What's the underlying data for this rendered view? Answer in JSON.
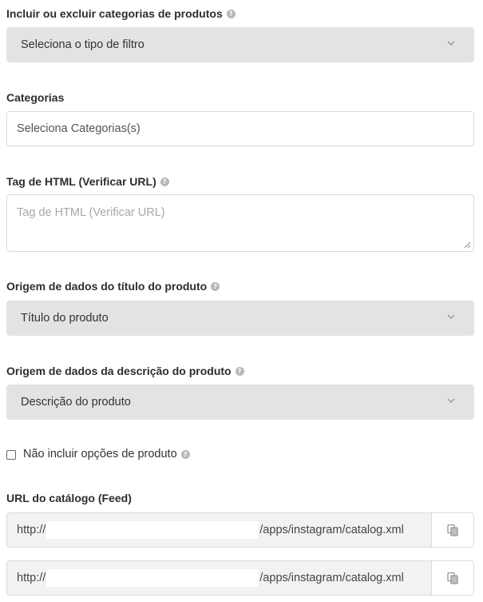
{
  "filter_type": {
    "label": "Incluir ou excluir categorias de produtos",
    "help_icon": "question-circle-icon",
    "value": "Seleciona o tipo de filtro"
  },
  "categories": {
    "label": "Categorias",
    "placeholder": "Seleciona Categorias(s)"
  },
  "html_tag": {
    "label": "Tag de HTML (Verificar URL)",
    "placeholder": "Tag de HTML (Verificar URL)"
  },
  "title_source": {
    "label": "Origem de dados do título do produto",
    "value": "Título do produto"
  },
  "description_source": {
    "label": "Origem de dados da descrição do produto",
    "value": "Descrição do produto"
  },
  "exclude_options": {
    "label": "Não incluir opções de produto",
    "checked": false
  },
  "catalog_url": {
    "label": "URL do catálogo (Feed)",
    "urls": [
      {
        "prefix": "http://",
        "suffix": "/apps/instagram/catalog.xml"
      },
      {
        "prefix": "http://",
        "suffix": "/apps/instagram/catalog.xml"
      }
    ],
    "copy_icon": "copy-icon"
  },
  "colors": {
    "select_bg": "#e3e3e3",
    "border": "#d9d9d9",
    "label_text": "#2d2d2d",
    "help_icon": "#b8b8b8"
  }
}
